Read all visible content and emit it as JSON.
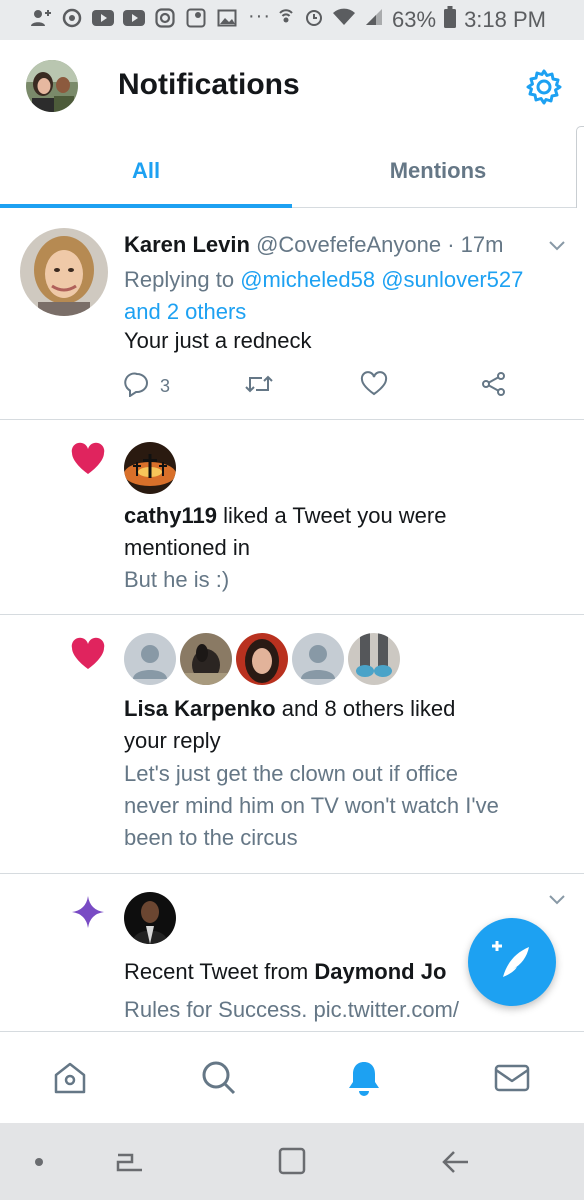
{
  "status_bar": {
    "battery": "63%",
    "time": "3:18 PM",
    "dots": "···"
  },
  "header": {
    "title": "Notifications"
  },
  "tabs": [
    {
      "label": "All",
      "active": true
    },
    {
      "label": "Mentions",
      "active": false
    }
  ],
  "tweet": {
    "name": "Karen Levin",
    "handle": "@CovefefeAnyone",
    "separator": "·",
    "time": "17m",
    "replying_prefix": "Replying to",
    "reply_user1": "@micheled58",
    "reply_user2": "@sunlover527",
    "reply_others": "and 2 others",
    "text": "Your just a redneck",
    "reply_count": "3"
  },
  "notifications": [
    {
      "type": "like",
      "actor": "cathy119",
      "action": "liked a Tweet you were",
      "action2": "mentioned in",
      "snippet": "But he is :)"
    },
    {
      "type": "like",
      "actor": "Lisa Karpenko",
      "action": "and 8 others liked",
      "action2": "your reply",
      "snippet1": "Let's just get the clown out if office",
      "snippet2": "never mind him on TV won't watch I've",
      "snippet3": "been to the circus"
    },
    {
      "type": "recent",
      "prefix": "Recent Tweet from",
      "actor": "Daymond Jo",
      "snippet": "Rules for Success. pic.twitter.com/"
    }
  ],
  "colors": {
    "accent": "#1da1f2",
    "heart": "#e0245e",
    "sparkle": "#794bc4",
    "secondary_text": "#657786"
  },
  "icons": {
    "settings": "gear-icon",
    "home": "home-icon",
    "search": "search-icon",
    "notifications": "bell-icon",
    "messages": "mail-icon",
    "compose": "compose-icon"
  }
}
